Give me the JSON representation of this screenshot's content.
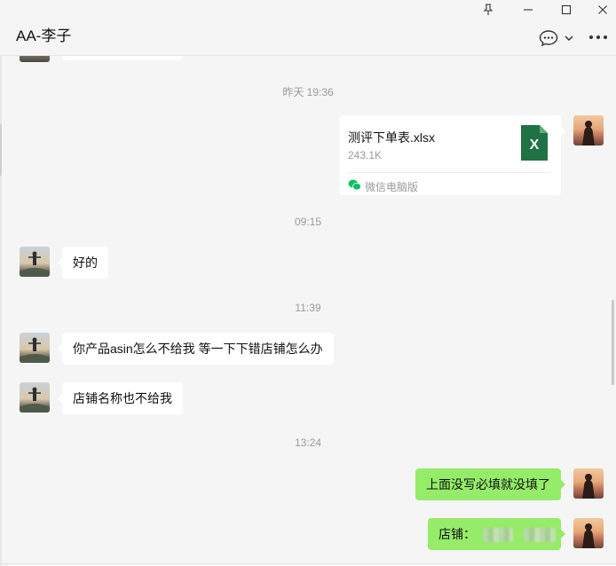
{
  "window": {
    "title": "AA-李子",
    "pin_glyph": "⊥",
    "minimize_glyph": "—",
    "maximize_glyph": "☐",
    "close_glyph": "✕"
  },
  "colors": {
    "background": "#f5f5f5",
    "bubble_self": "#95ec69",
    "bubble_other": "#ffffff",
    "excel_green": "#1f7244",
    "wechat_green": "#07c160"
  },
  "messages": [
    {
      "type": "timestamp",
      "text": "昨天 19:36"
    },
    {
      "type": "file",
      "sender": "self",
      "file_name": "测评下单表.xlsx",
      "file_size": "243.1K",
      "file_icon": "excel-icon",
      "icon_letter": "X",
      "source": "微信电脑版"
    },
    {
      "type": "timestamp",
      "text": "09:15"
    },
    {
      "type": "text",
      "sender": "other",
      "text": "好的"
    },
    {
      "type": "timestamp",
      "text": "11:39"
    },
    {
      "type": "text",
      "sender": "other",
      "text": "你产品asin怎么不给我 等一下下错店铺怎么办"
    },
    {
      "type": "text",
      "sender": "other",
      "text": "店铺名称也不给我"
    },
    {
      "type": "timestamp",
      "text": "13:24"
    },
    {
      "type": "text",
      "sender": "self",
      "text": "上面没写必填就没填了"
    },
    {
      "type": "text",
      "sender": "self",
      "text": "店铺："
    }
  ]
}
